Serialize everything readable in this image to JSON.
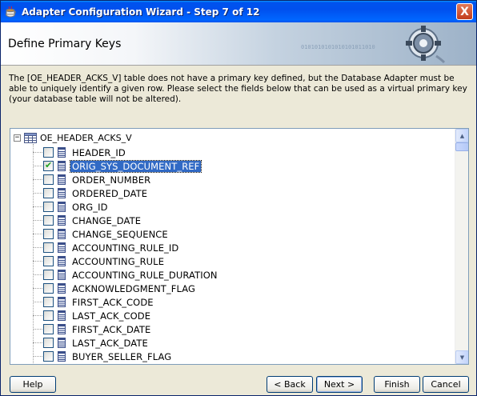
{
  "window": {
    "title": "Adapter Configuration Wizard - Step 7 of 12",
    "close_glyph": "X"
  },
  "header": {
    "heading": "Define Primary Keys",
    "decoration_text": "0101010101010101011010",
    "decoration_text2": "101010101"
  },
  "description": "The [OE_HEADER_ACKS_V] table does not have a primary key defined, but the Database Adapter must be able to uniquely identify a given row.  Please select the fields below that can be used as a virtual primary key (your database table will not be altered).",
  "tree": {
    "root_label": "OE_HEADER_ACKS_V",
    "expander_glyph": "−",
    "columns": [
      {
        "label": "HEADER_ID",
        "checked": false,
        "selected": false
      },
      {
        "label": "ORIG_SYS_DOCUMENT_REF",
        "checked": true,
        "selected": true
      },
      {
        "label": "ORDER_NUMBER",
        "checked": false,
        "selected": false
      },
      {
        "label": "ORDERED_DATE",
        "checked": false,
        "selected": false
      },
      {
        "label": "ORG_ID",
        "checked": false,
        "selected": false
      },
      {
        "label": "CHANGE_DATE",
        "checked": false,
        "selected": false
      },
      {
        "label": "CHANGE_SEQUENCE",
        "checked": false,
        "selected": false
      },
      {
        "label": "ACCOUNTING_RULE_ID",
        "checked": false,
        "selected": false
      },
      {
        "label": "ACCOUNTING_RULE",
        "checked": false,
        "selected": false
      },
      {
        "label": "ACCOUNTING_RULE_DURATION",
        "checked": false,
        "selected": false
      },
      {
        "label": "ACKNOWLEDGMENT_FLAG",
        "checked": false,
        "selected": false
      },
      {
        "label": "FIRST_ACK_CODE",
        "checked": false,
        "selected": false
      },
      {
        "label": "LAST_ACK_CODE",
        "checked": false,
        "selected": false
      },
      {
        "label": "FIRST_ACK_DATE",
        "checked": false,
        "selected": false
      },
      {
        "label": "LAST_ACK_DATE",
        "checked": false,
        "selected": false
      },
      {
        "label": "BUYER_SELLER_FLAG",
        "checked": false,
        "selected": false
      }
    ],
    "check_glyph": "✔"
  },
  "scrollbar": {
    "up_glyph": "▲",
    "down_glyph": "▼"
  },
  "buttons": {
    "help": "Help",
    "back": "< Back",
    "next": "Next >",
    "finish": "Finish",
    "cancel": "Cancel"
  },
  "colors": {
    "title_bar": "#0053ee",
    "selection": "#316ac5",
    "close_button": "#c23c1c"
  }
}
